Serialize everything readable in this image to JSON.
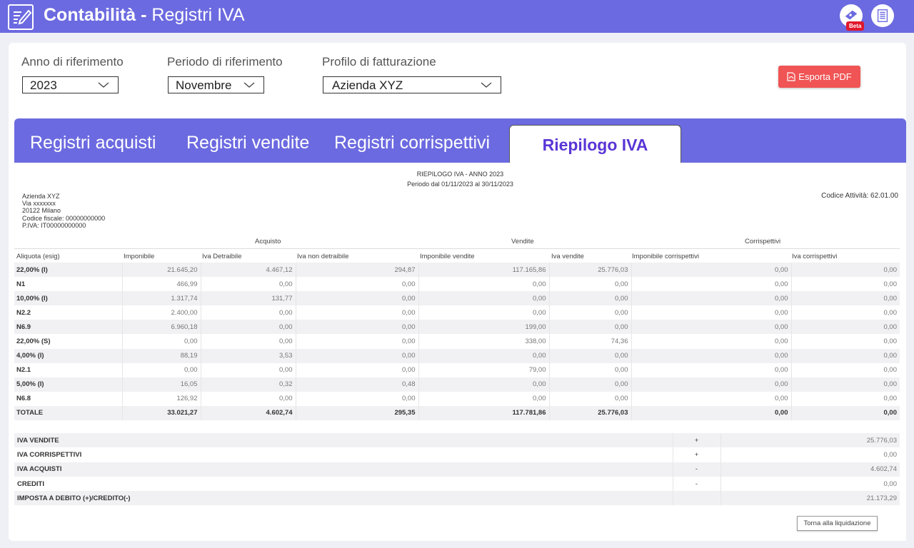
{
  "header": {
    "title_bold": "Contabilità -",
    "title_rest": " Registri IVA",
    "beta_label": "Beta"
  },
  "filters": {
    "anno": {
      "label": "Anno di riferimento",
      "value": "2023"
    },
    "periodo": {
      "label": "Periodo di riferimento",
      "value": "Novembre"
    },
    "profilo": {
      "label": "Profilo di fatturazione",
      "value": "Azienda XYZ"
    },
    "export_label": "Esporta PDF"
  },
  "tabs": [
    {
      "label": "Registri acquisti"
    },
    {
      "label": "Registri vendite"
    },
    {
      "label": "Registri corrispettivi"
    },
    {
      "label": "Riepilogo IVA"
    }
  ],
  "report": {
    "title": "RIEPILOGO IVA - ANNO 2023",
    "period": "Periodo dal 01/11/2023 al 30/11/2023",
    "company_lines": [
      "Azienda XYZ",
      "Via xxxxxxx",
      "20122 Milano",
      "Codice fiscale: 00000000000",
      "P.IVA: IT00000000000"
    ],
    "codice_attivita": "Codice Attività: 62.01.00",
    "groups": {
      "acquisto": "Acquisto",
      "vendite": "Vendite",
      "corrispettivi": "Corrispettivi"
    },
    "columns": [
      "Aliquota (esig)",
      "Imponibile",
      "Iva Detraibile",
      "Iva non detraibile",
      "Imponibile vendite",
      "Iva vendite",
      "Imponibile corrispettivi",
      "Iva corrispettivi"
    ],
    "rows": [
      [
        "22,00% (I)",
        "21.645,20",
        "4.467,12",
        "294,87",
        "117.165,86",
        "25.776,03",
        "0,00",
        "0,00"
      ],
      [
        "N1",
        "466,99",
        "0,00",
        "0,00",
        "0,00",
        "0,00",
        "0,00",
        "0,00"
      ],
      [
        "10,00% (I)",
        "1.317,74",
        "131,77",
        "0,00",
        "0,00",
        "0,00",
        "0,00",
        "0,00"
      ],
      [
        "N2.2",
        "2.400,00",
        "0,00",
        "0,00",
        "0,00",
        "0,00",
        "0,00",
        "0,00"
      ],
      [
        "N6.9",
        "6.960,18",
        "0,00",
        "0,00",
        "199,00",
        "0,00",
        "0,00",
        "0,00"
      ],
      [
        "22,00% (S)",
        "0,00",
        "0,00",
        "0,00",
        "338,00",
        "74,36",
        "0,00",
        "0,00"
      ],
      [
        "4,00% (I)",
        "88,19",
        "3,53",
        "0,00",
        "0,00",
        "0,00",
        "0,00",
        "0,00"
      ],
      [
        "N2.1",
        "0,00",
        "0,00",
        "0,00",
        "79,00",
        "0,00",
        "0,00",
        "0,00"
      ],
      [
        "5,00% (I)",
        "16,05",
        "0,32",
        "0,48",
        "0,00",
        "0,00",
        "0,00",
        "0,00"
      ],
      [
        "N6.8",
        "126,92",
        "0,00",
        "0,00",
        "0,00",
        "0,00",
        "0,00",
        "0,00"
      ]
    ],
    "total": [
      "TOTALE",
      "33.021,27",
      "4.602,74",
      "295,35",
      "117.781,86",
      "25.776,03",
      "0,00",
      "0,00"
    ],
    "summary": [
      {
        "label": "IVA VENDITE",
        "sign": "+",
        "value": "25.776,03"
      },
      {
        "label": "IVA CORRISPETTIVI",
        "sign": "+",
        "value": "0,00"
      },
      {
        "label": "IVA ACQUISTI",
        "sign": "-",
        "value": "4.602,74"
      },
      {
        "label": "CREDITI",
        "sign": "-",
        "value": "0,00"
      },
      {
        "label": "IMPOSTA A DEBITO (+)/CREDITO(-)",
        "sign": "",
        "value": "21.173,29"
      }
    ],
    "back_label": "Torna alla liquidazione"
  }
}
